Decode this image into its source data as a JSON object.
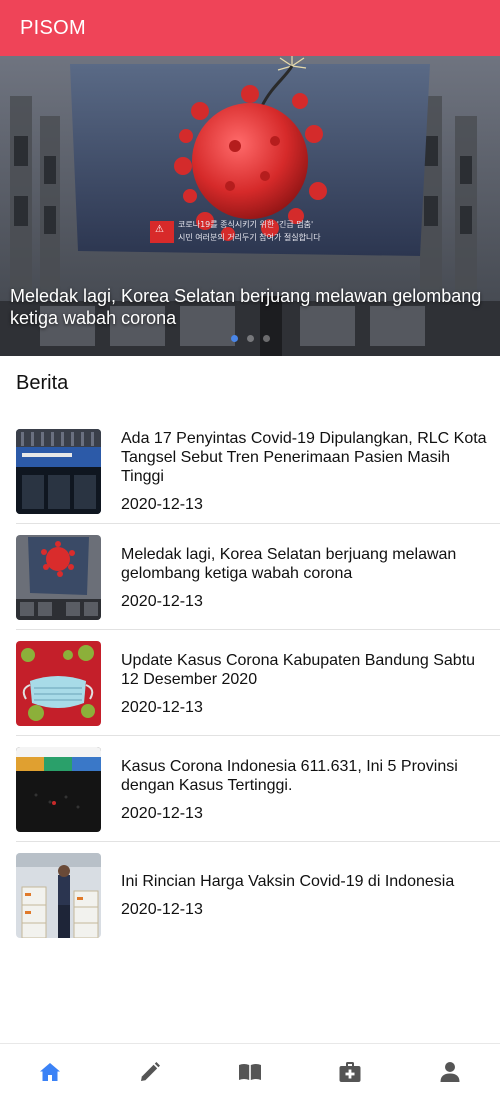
{
  "app": {
    "title": "PISOM"
  },
  "hero": {
    "caption": "Meledak lagi, Korea Selatan berjuang melawan gelombang ketiga wabah corona",
    "banner_text_line1": "코로나19를 종식시키기 위한 '긴급 멈춤'",
    "banner_text_line2": "시민 여러분의 거리두기 참여가 절실합니다",
    "slides": 3,
    "active_slide": 1
  },
  "section": {
    "title": "Berita"
  },
  "news": [
    {
      "title": "Ada 17 Penyintas Covid-19 Dipulangkan, RLC Kota Tangsel Sebut Tren Penerimaan Pasien Masih Tinggi",
      "date": "2020-12-13",
      "thumb": "building-night"
    },
    {
      "title": "Meledak lagi, Korea Selatan berjuang melawan gelombang ketiga wabah corona",
      "date": "2020-12-13",
      "thumb": "korea-virus-banner"
    },
    {
      "title": "Update Kasus Corona Kabupaten Bandung Sabtu 12 Desember 2020",
      "date": "2020-12-13",
      "thumb": "mask-virus-red"
    },
    {
      "title": "Kasus Corona Indonesia 611.631, Ini 5 Provinsi dengan Kasus Tertinggi.",
      "date": "2020-12-13",
      "thumb": "dashboard-map"
    },
    {
      "title": "Ini Rincian Harga Vaksin Covid-19 di Indonesia",
      "date": "2020-12-13",
      "thumb": "vaccine-boxes"
    }
  ],
  "nav": [
    {
      "name": "home-icon",
      "active": true
    },
    {
      "name": "pencil-icon",
      "active": false
    },
    {
      "name": "book-icon",
      "active": false
    },
    {
      "name": "medkit-icon",
      "active": false
    },
    {
      "name": "user-icon",
      "active": false
    }
  ],
  "colors": {
    "appbar": "#ef4458",
    "accent": "#3b82f6",
    "nav_inactive": "#555555"
  }
}
